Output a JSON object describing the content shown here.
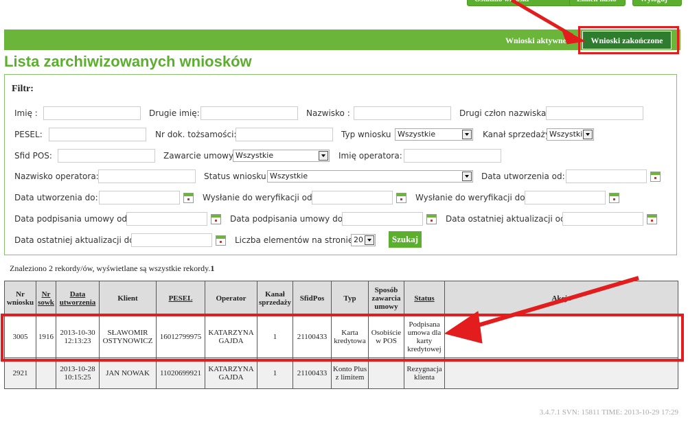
{
  "top_buttons": [
    "Ostatnio wnioski",
    "Zmień hasło",
    "Wyloguj"
  ],
  "nav": {
    "active_tab": "Wnioski aktywne",
    "closed_tab": "Wnioski zakończone"
  },
  "page_title": "Lista zarchiwizowanych wniosków",
  "filter": {
    "title": "Filtr:",
    "labels": {
      "first_name": "Imię :",
      "second_name": "Drugie imię:",
      "last_name": "Nazwisko :",
      "second_last": "Drugi człon nazwiska:",
      "pesel": "PESEL:",
      "id_doc": "Nr dok. tożsamości:",
      "app_type": "Typ wniosku",
      "sales_channel": "Kanał sprzedaży",
      "sfid_pos": "Sfid POS:",
      "contract": "Zawarcie umowy",
      "operator_first": "Imię operatora:",
      "operator_last": "Nazwisko operatora:",
      "app_status": "Status wniosku",
      "created_from": "Data utworzenia od:",
      "created_to": "Data utworzenia do:",
      "verif_from": "Wysłanie do weryfikacji od:",
      "verif_to": "Wysłanie do weryfikacji do:",
      "signed_from": "Data podpisania umowy od:",
      "signed_to": "Data podpisania umowy do:",
      "updated_from": "Data ostatniej aktualizacji od:",
      "updated_to": "Data ostatniej aktualizacji do:",
      "per_page": "Liczba elementów na stronie:"
    },
    "selects": {
      "app_type": "Wszystkie",
      "sales_channel": "Wszystkie",
      "contract": "Wszystkie",
      "app_status": "Wszystkie",
      "per_page": "20"
    },
    "search_button": "Szukaj"
  },
  "found_text": "Znaleziono 2 rekordy/ów, wyświetlane są wszystkie rekordy.",
  "found_page": "1",
  "table": {
    "headers": [
      "Nr wniosku",
      "Nr sowk",
      "Data utworzenia",
      "Klient",
      "PESEL",
      "Operator",
      "Kanał sprzedaży",
      "SfidPos",
      "Typ",
      "Sposób zawarcia umowy",
      "Status",
      "Akcja"
    ],
    "rows": [
      [
        "3005",
        "1916",
        "2013-10-30 12:13:23",
        "SŁAWOMIR OSTYNOWICZ",
        "16012799975",
        "KATARZYNA GAJDA",
        "1",
        "21100433",
        "Karta kredytowa",
        "Osobiście w POS",
        "Podpisana umowa dla karty kredytowej",
        ""
      ],
      [
        "2921",
        "",
        "2013-10-28 10:15:25",
        "JAN NOWAK",
        "11020699921",
        "KATARZYNA GAJDA",
        "1",
        "21100433",
        "Konto Plus z limitem",
        "",
        "Rezygnacja klienta",
        ""
      ]
    ]
  },
  "version": "3.4.7.1 SVN: 15811 TIME: 2013-10-29 17:29",
  "colors": {
    "brand_green": "#5cae2e",
    "tab_dark_green": "#2e7d2e",
    "highlight_red": "#e31d1d"
  }
}
